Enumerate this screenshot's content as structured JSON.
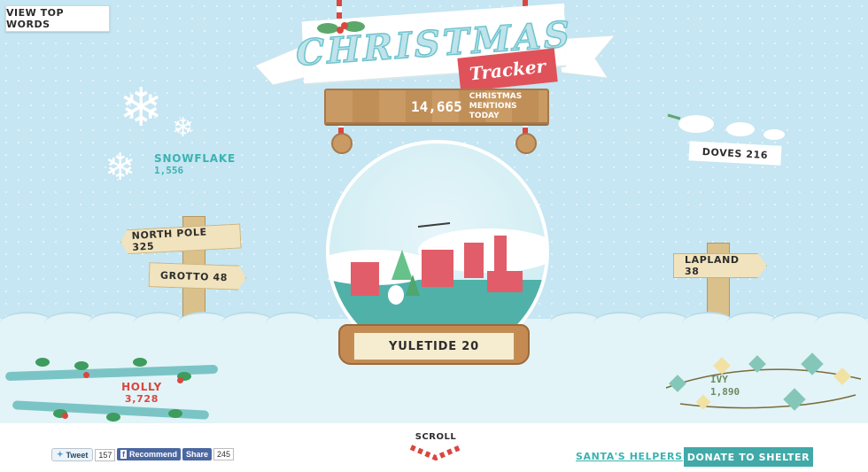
{
  "toolbar": {
    "view_top_words": "VIEW TOP WORDS"
  },
  "header": {
    "title": "CHRISTMAS",
    "subtitle": "Tracker",
    "mentions_count": "14,665",
    "mentions_label": "CHRISTMAS MENTIONS TODAY"
  },
  "words": {
    "snowflake": {
      "label": "SNOWFLAKE",
      "count": "1,556"
    },
    "doves": {
      "label": "DOVES 216"
    },
    "north_pole": {
      "label": "NORTH POLE 325"
    },
    "grotto": {
      "label": "GROTTO 48"
    },
    "lapland": {
      "label": "LAPLAND 38"
    },
    "yuletide": {
      "label": "YULETIDE 20"
    },
    "holly": {
      "label": "HOLLY",
      "count": "3,728"
    },
    "ivy": {
      "label": "IVY",
      "count": "1,890"
    }
  },
  "footer": {
    "tweet": "Tweet",
    "tweet_count": "157",
    "recommend": "Recommend",
    "share": "Share",
    "share_count": "245",
    "scroll": "SCROLL",
    "santas_helpers": "SANTA'S HELPERS",
    "donate": "DONATE TO SHELTER"
  },
  "colors": {
    "sky": "#c5e6f2",
    "teal": "#3bb3b0",
    "red": "#d9473f",
    "wood": "#c99a63"
  }
}
